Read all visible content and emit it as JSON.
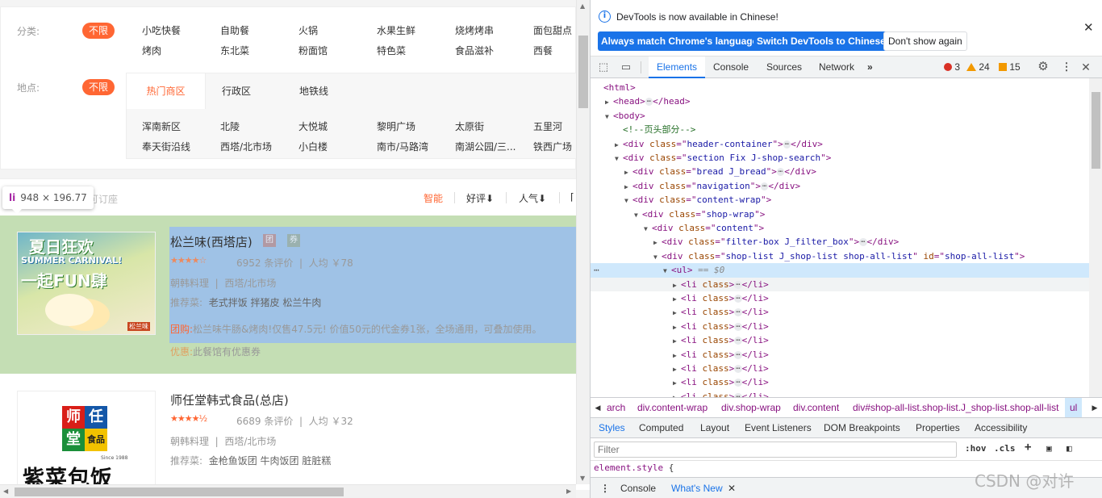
{
  "site": {
    "filters": {
      "category_label": "分类:",
      "category_all": "不限",
      "categories": [
        "小吃快餐",
        "自助餐",
        "火锅",
        "水果生鲜",
        "烧烤烤串",
        "面包甜点",
        "烤肉",
        "东北菜",
        "粉面馆",
        "特色菜",
        "食品滋补",
        "西餐"
      ],
      "location_label": "地点:",
      "location_all": "不限",
      "location_tabs": [
        "热门商区",
        "行政区",
        "地铁线"
      ],
      "locations": [
        "浑南新区",
        "北陵",
        "大悦城",
        "黎明广场",
        "太原街",
        "五里河",
        "奉天街沿线",
        "西塔/北市场",
        "小白楼",
        "南市/马路湾",
        "南湖公园/三...",
        "铁西广场"
      ]
    },
    "sortbar": {
      "orderable": "可订座",
      "smart": "智能",
      "rating": "好评⬇",
      "popularity": "人气⬇"
    },
    "tooltip": {
      "tag": "li",
      "size": "948 × 196.77"
    },
    "shops": [
      {
        "name": "松兰味(西塔店)",
        "img_title": "夏日狂欢",
        "img_sub": "SUMMER CARNIVAL!",
        "img_main": "一起FUN肆",
        "img_corner": "松兰味",
        "rating_stars": 4,
        "reviews": "6952 条评价",
        "avg": "人均 ￥78",
        "cuisine": "朝韩料理",
        "area": "西塔/北市场",
        "rec_label": "推荐菜:",
        "dishes": "老式拌饭 拌猪皮 松兰牛肉",
        "deal_tag": "团购:",
        "deal": "松兰味牛肠&烤肉!仅售47.5元! 价值50元的代金券1张，全场通用，可叠加使用。",
        "promo_tag": "优惠:",
        "promo": "此餐馆有优惠券"
      },
      {
        "name": "师任堂韩式食品(总店)",
        "logo_chars": [
          "师",
          "任",
          "堂",
          "食品"
        ],
        "logo_text": "紫菜包饭",
        "logo_since": "Since 1988",
        "rating_stars": 4.5,
        "reviews": "6689 条评价",
        "avg": "人均 ￥32",
        "cuisine": "朝韩料理",
        "area": "西塔/北市场",
        "rec_label": "推荐菜:",
        "dishes": "金枪鱼饭团 牛肉饭团 脏脏糕"
      }
    ]
  },
  "devtools": {
    "banner": {
      "message": "DevTools is now available in Chinese!",
      "btn_match": "Always match Chrome's language",
      "btn_switch": "Switch DevTools to Chinese",
      "btn_dismiss": "Don't show again"
    },
    "tabs": [
      "Elements",
      "Console",
      "Sources",
      "Network"
    ],
    "counts": {
      "errors": "3",
      "warnings": "24",
      "issues": "15"
    },
    "dom": [
      {
        "indent": 0,
        "tw": "",
        "tag": "<html>"
      },
      {
        "indent": 1,
        "tw": "▶",
        "tag": "<head>",
        "ell": true,
        "close": "</head>"
      },
      {
        "indent": 1,
        "tw": "▼",
        "tag": "<body>"
      },
      {
        "indent": 2,
        "tw": "",
        "comment": "<!--页头部分-->"
      },
      {
        "indent": 2,
        "tw": "▶",
        "open": "<div",
        "attrs": [
          [
            "class",
            "header-container"
          ]
        ],
        "ell": true,
        "close": "</div>"
      },
      {
        "indent": 2,
        "tw": "▼",
        "open": "<div",
        "attrs": [
          [
            "class",
            "section Fix J-shop-search"
          ]
        ]
      },
      {
        "indent": 3,
        "tw": "▶",
        "open": "<div",
        "attrs": [
          [
            "class",
            "bread J_bread"
          ]
        ],
        "ell": true,
        "close": "</div>"
      },
      {
        "indent": 3,
        "tw": "▶",
        "open": "<div",
        "attrs": [
          [
            "class",
            "navigation"
          ]
        ],
        "ell": true,
        "close": "</div>"
      },
      {
        "indent": 3,
        "tw": "▼",
        "open": "<div",
        "attrs": [
          [
            "class",
            "content-wrap"
          ]
        ]
      },
      {
        "indent": 4,
        "tw": "▼",
        "open": "<div",
        "attrs": [
          [
            "class",
            "shop-wrap"
          ]
        ]
      },
      {
        "indent": 5,
        "tw": "▼",
        "open": "<div",
        "attrs": [
          [
            "class",
            "content"
          ]
        ]
      },
      {
        "indent": 6,
        "tw": "▶",
        "open": "<div",
        "attrs": [
          [
            "class",
            "filter-box J_filter_box"
          ]
        ],
        "ell": true,
        "close": "</div>"
      },
      {
        "indent": 6,
        "tw": "▼",
        "open": "<div",
        "attrs": [
          [
            "class",
            "shop-list J_shop-list shop-all-list"
          ],
          [
            "id",
            "shop-all-list"
          ]
        ]
      },
      {
        "indent": 7,
        "tw": "▼",
        "tag": "<ul>",
        "eq": "== $0",
        "sel": true
      },
      {
        "indent": 8,
        "tw": "▶",
        "li": true,
        "hover": true
      },
      {
        "indent": 8,
        "tw": "▶",
        "li": true
      },
      {
        "indent": 8,
        "tw": "▶",
        "li": true
      },
      {
        "indent": 8,
        "tw": "▶",
        "li": true
      },
      {
        "indent": 8,
        "tw": "▶",
        "li": true
      },
      {
        "indent": 8,
        "tw": "▶",
        "li": true
      },
      {
        "indent": 8,
        "tw": "▶",
        "li": true
      },
      {
        "indent": 8,
        "tw": "▶",
        "li": true
      },
      {
        "indent": 8,
        "tw": "▶",
        "li": true
      }
    ],
    "breadcrumbs": [
      "arch",
      "div.content-wrap",
      "div.shop-wrap",
      "div.content",
      "div#shop-all-list.shop-list.J_shop-list.shop-all-list",
      "ul"
    ],
    "subtabs": [
      "Styles",
      "Computed",
      "Layout",
      "Event Listeners",
      "DOM Breakpoints",
      "Properties",
      "Accessibility"
    ],
    "filter_placeholder": "Filter",
    "hov": ":hov",
    "cls": ".cls",
    "style_selector": "element.style",
    "style_brace": "{",
    "drawer": {
      "console": "Console",
      "whats_new": "What's New"
    }
  },
  "watermark": "CSDN @对许"
}
